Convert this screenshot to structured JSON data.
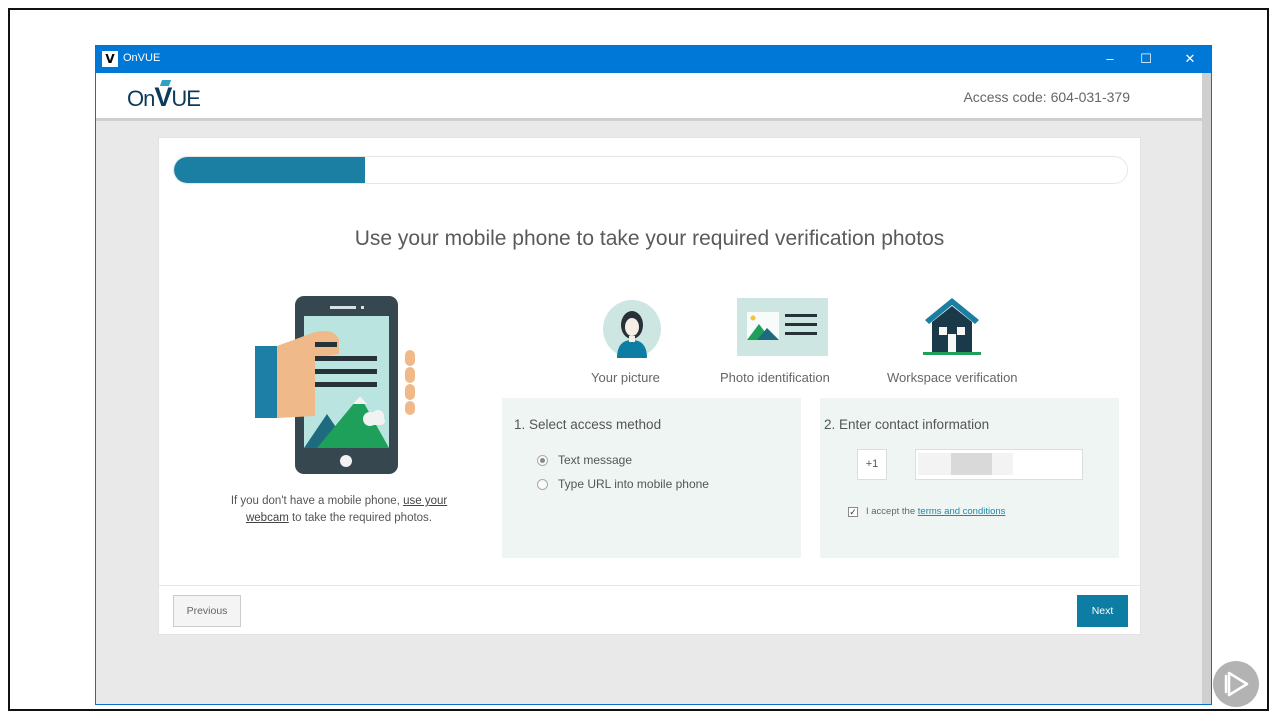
{
  "window": {
    "title": "OnVUE",
    "icon_letter": "V"
  },
  "header": {
    "logo_text_left": "On",
    "logo_text_v": "V",
    "logo_text_right": "UE",
    "access_label": "Access code:",
    "access_code": "604-031-379"
  },
  "progress": {
    "fraction": 0.2
  },
  "headline": "Use your mobile phone to take your required verification photos",
  "webcam_note": {
    "before": "If you don't have a mobile phone, ",
    "link": "use your webcam",
    "after": " to take the required photos."
  },
  "steps": [
    {
      "label": "Your picture",
      "icon": "person-avatar-icon"
    },
    {
      "label": "Photo identification",
      "icon": "id-card-icon"
    },
    {
      "label": "Workspace verification",
      "icon": "house-icon"
    }
  ],
  "access_method": {
    "title": "1. Select access method",
    "options": [
      {
        "label": "Text message",
        "selected": true
      },
      {
        "label": "Type URL into mobile phone",
        "selected": false
      }
    ]
  },
  "contact": {
    "title": "2. Enter contact information",
    "country_code": "+1",
    "phone_value": "",
    "terms_prefix": "I accept the ",
    "terms_link": "terms and conditions",
    "terms_checked": true
  },
  "footer": {
    "previous": "Previous",
    "next": "Next"
  },
  "colors": {
    "accent": "#0e7da3",
    "titlebar": "#0078d7",
    "panel_bg": "#eef5f2",
    "illustration_teal": "#3a9a8a"
  }
}
